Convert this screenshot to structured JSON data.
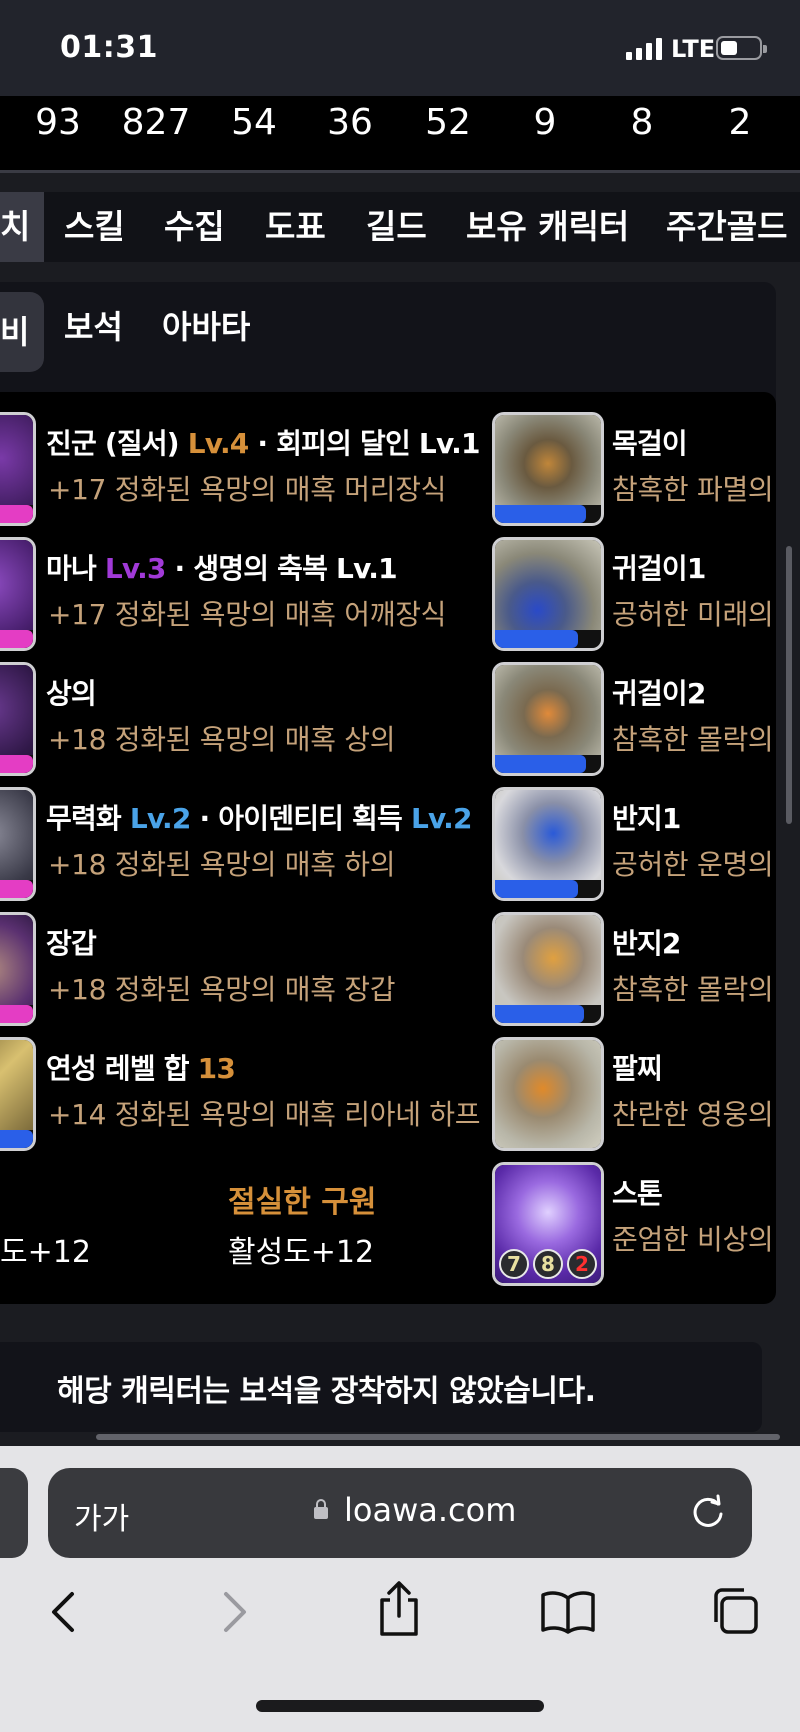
{
  "status_bar": {
    "time": "01:31",
    "network": "LTE"
  },
  "stats": [
    "93",
    "827",
    "54",
    "36",
    "52",
    "9",
    "8",
    "2"
  ],
  "tabs": [
    "치",
    "스킬",
    "수집",
    "도표",
    "길드",
    "보유 캐릭터",
    "주간골드"
  ],
  "subtabs": [
    "비",
    "보석",
    "아바타"
  ],
  "left_items": [
    {
      "title_pre": "진군 (질서) ",
      "title_lv": "Lv.4",
      "title_post": " · 회피의 달인 Lv.1",
      "lv_color": "gold",
      "desc": "+17 정화된 욕망의 매혹 머리장식",
      "bar": 0.8,
      "bar_color": "#e43dc4"
    },
    {
      "title_pre": "마나 ",
      "title_lv": "Lv.3",
      "title_post": " · 생명의 축복 Lv.1",
      "lv_color": "purple",
      "desc": "+17 정화된 욕망의 매혹 어깨장식",
      "bar": 0.8,
      "bar_color": "#e43dc4"
    },
    {
      "title_pre": "상의",
      "title_lv": "",
      "title_post": "",
      "lv_color": "",
      "desc": "+18 정화된 욕망의 매혹 상의",
      "bar": 0.8,
      "bar_color": "#e43dc4"
    },
    {
      "title_pre": "무력화 ",
      "title_lv": "Lv.2",
      "title_post": " · 아이덴티티 획득 ",
      "title_lv2": "Lv.2",
      "lv_color": "blue",
      "desc": "+18 정화된 욕망의 매혹 하의",
      "bar": 0.8,
      "bar_color": "#e43dc4"
    },
    {
      "title_pre": "장갑",
      "title_lv": "",
      "title_post": "",
      "lv_color": "",
      "desc": "+18 정화된 욕망의 매혹 장갑",
      "bar": 0.8,
      "bar_color": "#e43dc4"
    },
    {
      "title_pre": "연성 레벨 합 ",
      "title_lv": "13",
      "title_post": "",
      "lv_color": "gold",
      "desc": "+14 정화된 욕망의 매혹 리아네 하프",
      "bar": 0.55,
      "bar_color": "#2a5fe8"
    }
  ],
  "right_items": [
    {
      "title": "목걸이",
      "desc": "참혹한 파멸의",
      "bar": 0.86
    },
    {
      "title": "귀걸이1",
      "desc": "공허한 미래의",
      "bar": 0.78
    },
    {
      "title": "귀걸이2",
      "desc": "참혹한 몰락의",
      "bar": 0.86
    },
    {
      "title": "반지1",
      "desc": "공허한 운명의",
      "bar": 0.78
    },
    {
      "title": "반지2",
      "desc": "참혹한 몰락의",
      "bar": 0.84
    },
    {
      "title": "팔찌",
      "desc": "찬란한 영웅의",
      "bar": 0
    },
    {
      "title": "스톤",
      "desc": "준엄한 비상의",
      "bar": 0
    }
  ],
  "stone_levels": [
    "7",
    "8",
    "2"
  ],
  "bottom": {
    "left_val": "도+12",
    "name": "절실한 구원",
    "right_val": "활성도+12"
  },
  "notice": "해당 캐릭터는 보석을 장착하지 않았습니다.",
  "browser": {
    "text_size_label": "가가",
    "url": "loawa.com"
  }
}
